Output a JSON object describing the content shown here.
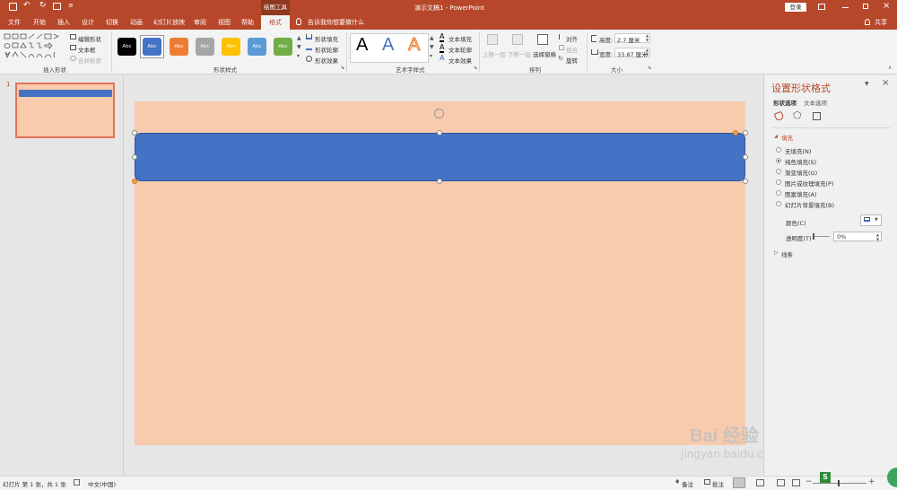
{
  "titlebar": {
    "context_tab": "绘图工具",
    "title": "演示文稿1  -  PowerPoint",
    "login": "登录"
  },
  "tabs": [
    "文件",
    "开始",
    "插入",
    "设计",
    "切换",
    "动画",
    "幻灯片放映",
    "审阅",
    "视图",
    "帮助",
    "格式"
  ],
  "active_tab": "格式",
  "tell_me": "告诉我你想要做什么",
  "share": "共享",
  "ribbon": {
    "insert_shapes": {
      "label": "插入形状",
      "edit_shape": "编辑形状",
      "text_box": "文本框",
      "merge_shapes": "合并形状"
    },
    "shape_styles": {
      "label": "形状样式",
      "swatch_text": "Abc",
      "fill": "形状填充",
      "outline": "形状轮廓",
      "effect": "形状效果"
    },
    "wordart": {
      "label": "艺术字样式",
      "glyph": "A",
      "text_fill": "文本填充",
      "text_outline": "文本轮廓",
      "text_effect": "文本效果"
    },
    "arrange": {
      "label": "排列",
      "bring_forward": "上移一层",
      "send_backward": "下移一层",
      "selection_pane": "选择窗格",
      "align": "对齐",
      "group": "组合",
      "rotate": "旋转"
    },
    "size": {
      "label": "大小",
      "height_label": "高度:",
      "height": "2.7 厘米",
      "width_label": "宽度:",
      "width": "33.87 厘米"
    }
  },
  "colors": {
    "accent": "#b7472a",
    "slide_bg": "#f8cbad",
    "shape_fill": "#4472c4",
    "swatches": [
      "#000000",
      "#4472c4",
      "#ed7d31",
      "#a5a5a5",
      "#ffc000",
      "#5b9bd5",
      "#70ad47"
    ]
  },
  "thumbnails": {
    "slide_number": "1"
  },
  "format_pane": {
    "title": "设置形状格式",
    "tab_shape": "形状选项",
    "tab_text": "文本选项",
    "fill_section": "填充",
    "options": [
      "无填充(N)",
      "纯色填充(S)",
      "渐变填充(G)",
      "图片或纹理填充(P)",
      "图案填充(A)",
      "幻灯片背景填充(B)"
    ],
    "selected_index": 1,
    "color_label": "颜色(C)",
    "transparency_label": "透明度(T)",
    "transparency_value": "0%",
    "line_section": "线条"
  },
  "statusbar": {
    "slide_info": "幻灯片 第 1 张，共 1 张",
    "language": "中文(中国)",
    "notes": "备注",
    "comments": "批注"
  },
  "watermark": {
    "brand": "Bai 经验",
    "url": "jingyan.baidu.com"
  }
}
